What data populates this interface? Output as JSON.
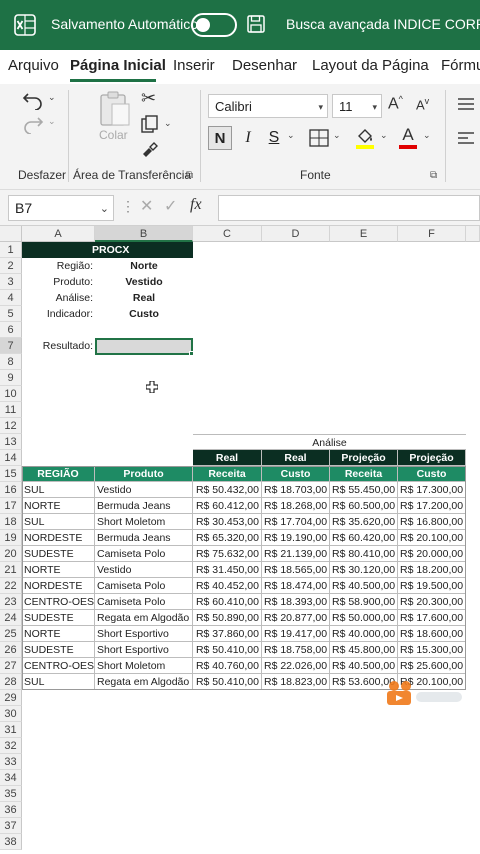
{
  "titlebar": {
    "autosave_label": "Salvamento Automático",
    "filename": "Busca avançada INDICE CORRESP -",
    "autosave_on": false,
    "accent": "#1e7145"
  },
  "tabs": [
    {
      "label": "Arquivo"
    },
    {
      "label": "Página Inicial"
    },
    {
      "label": "Inserir"
    },
    {
      "label": "Desenhar"
    },
    {
      "label": "Layout da Página"
    },
    {
      "label": "Fórmu"
    }
  ],
  "ribbon": {
    "undo_group": "Desfazer",
    "clipboard_group": "Área de Transferência",
    "paste_label": "Colar",
    "font_group": "Fonte",
    "font_name": "Calibri",
    "font_size": "11",
    "bold_label": "N",
    "italic_label": "I",
    "underline_label": "S",
    "increase_font": "A",
    "decrease_font": "A",
    "font_color_letter": "A",
    "highlight_color": "#ffff00",
    "font_color": "#e00000"
  },
  "formula_bar": {
    "name_box": "B7",
    "fx_label": "fx",
    "formula": ""
  },
  "columns": [
    {
      "letter": "A"
    },
    {
      "letter": "B"
    },
    {
      "letter": "C"
    },
    {
      "letter": "D"
    },
    {
      "letter": "E"
    },
    {
      "letter": "F"
    }
  ],
  "row_numbers": [
    "1",
    "2",
    "3",
    "4",
    "5",
    "6",
    "7",
    "8",
    "9",
    "10",
    "11",
    "12",
    "13",
    "14",
    "15",
    "16",
    "17",
    "18",
    "19",
    "20",
    "21",
    "22",
    "23",
    "24",
    "25",
    "26",
    "27",
    "28",
    "29",
    "30",
    "31",
    "32",
    "33",
    "34",
    "35",
    "36",
    "37",
    "38"
  ],
  "procx": {
    "title": "PROCX",
    "rows": [
      {
        "label": "Região:",
        "value": "Norte"
      },
      {
        "label": "Produto:",
        "value": "Vestido"
      },
      {
        "label": "Análise:",
        "value": "Real"
      },
      {
        "label": "Indicador:",
        "value": "Custo"
      }
    ],
    "result_label": "Resultado:"
  },
  "table": {
    "group_header": "Análise",
    "top_headers": [
      "Real",
      "Real",
      "Projeção",
      "Projeção"
    ],
    "headers": [
      "REGIÃO",
      "Produto",
      "Receita",
      "Custo",
      "Receita",
      "Custo"
    ],
    "rows": [
      [
        "SUL",
        "Vestido",
        "R$ 50.432,00",
        "R$ 18.703,00",
        "R$ 55.450,00",
        "R$ 17.300,00"
      ],
      [
        "NORTE",
        "Bermuda Jeans",
        "R$ 60.412,00",
        "R$ 18.268,00",
        "R$ 60.500,00",
        "R$ 17.200,00"
      ],
      [
        "SUL",
        "Short Moletom",
        "R$ 30.453,00",
        "R$ 17.704,00",
        "R$ 35.620,00",
        "R$ 16.800,00"
      ],
      [
        "NORDESTE",
        "Bermuda Jeans",
        "R$ 65.320,00",
        "R$ 19.190,00",
        "R$ 60.420,00",
        "R$ 20.100,00"
      ],
      [
        "SUDESTE",
        "Camiseta Polo",
        "R$ 75.632,00",
        "R$ 21.139,00",
        "R$ 80.410,00",
        "R$ 20.000,00"
      ],
      [
        "NORTE",
        "Vestido",
        "R$ 31.450,00",
        "R$ 18.565,00",
        "R$ 30.120,00",
        "R$ 18.200,00"
      ],
      [
        "NORDESTE",
        "Camiseta Polo",
        "R$ 40.452,00",
        "R$ 18.474,00",
        "R$ 40.500,00",
        "R$ 19.500,00"
      ],
      [
        "CENTRO-OESTE",
        "Camiseta Polo",
        "R$ 60.410,00",
        "R$ 18.393,00",
        "R$ 58.900,00",
        "R$ 20.300,00"
      ],
      [
        "SUDESTE",
        "Regata em Algodão",
        "R$ 50.890,00",
        "R$ 20.877,00",
        "R$ 50.000,00",
        "R$ 17.600,00"
      ],
      [
        "NORTE",
        "Short Esportivo",
        "R$ 37.860,00",
        "R$ 19.417,00",
        "R$ 40.000,00",
        "R$ 18.600,00"
      ],
      [
        "SUDESTE",
        "Short Esportivo",
        "R$ 50.410,00",
        "R$ 18.758,00",
        "R$ 45.800,00",
        "R$ 15.300,00"
      ],
      [
        "CENTRO-OESTE",
        "Short Moletom",
        "R$ 40.760,00",
        "R$ 22.026,00",
        "R$ 40.500,00",
        "R$ 25.600,00"
      ],
      [
        "SUL",
        "Regata em Algodão",
        "R$ 50.410,00",
        "R$ 18.823,00",
        "R$ 53.600,00",
        "R$ 20.100,00"
      ]
    ]
  },
  "colors": {
    "dark_header": "#0b2e22",
    "green_header": "#1e8b64",
    "selection": "#217346"
  }
}
